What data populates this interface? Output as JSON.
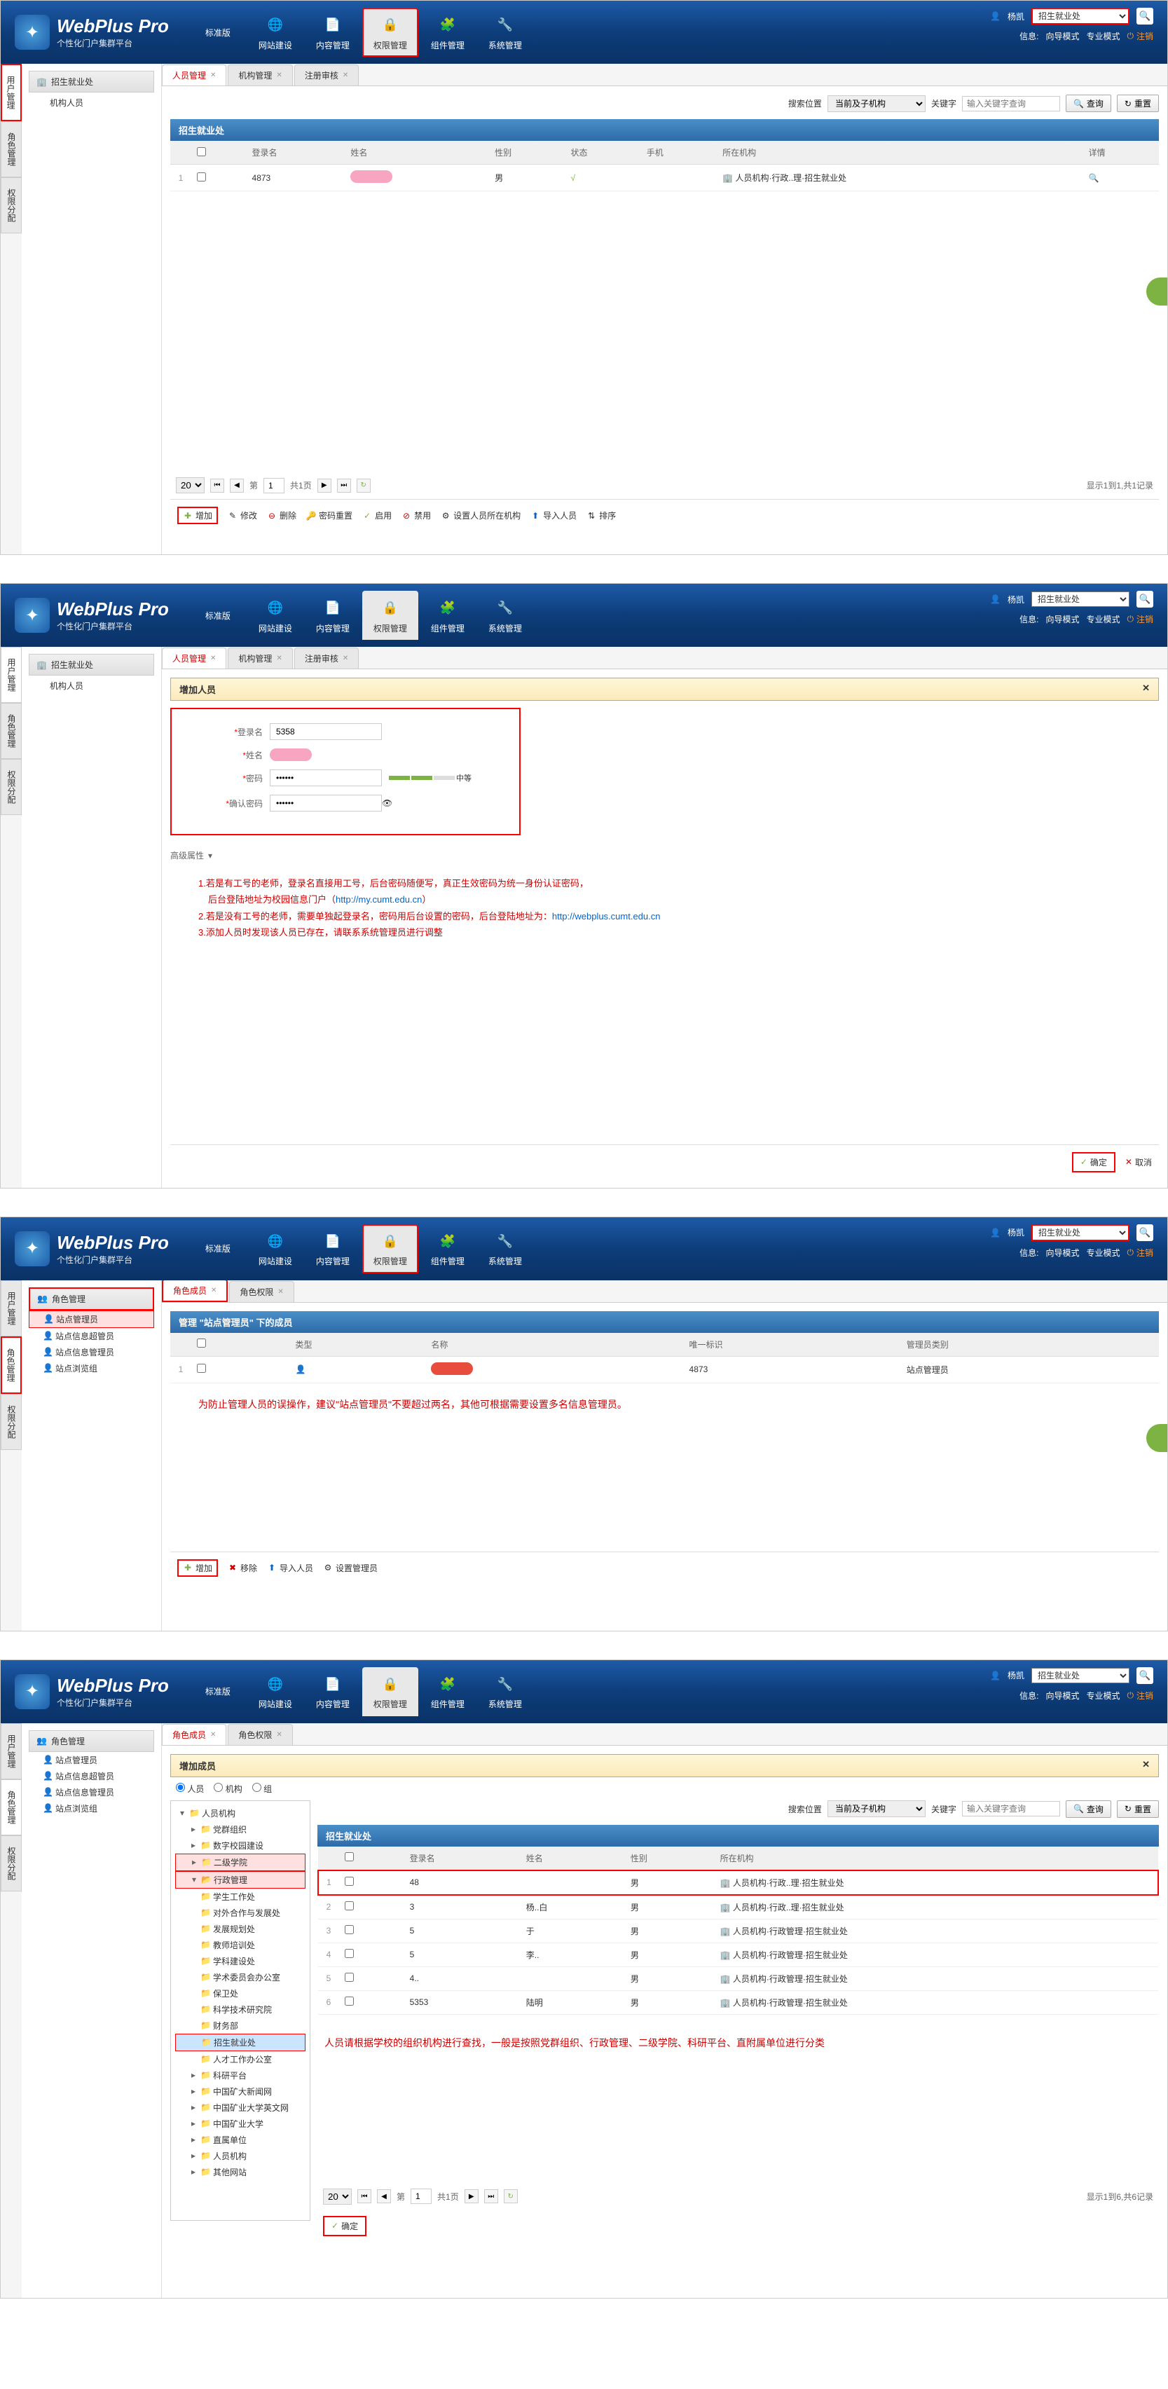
{
  "logo": {
    "title": "WebPlus Pro",
    "sub": "个性化门户集群平台"
  },
  "nav": {
    "std": "标准版",
    "site": "网站建设",
    "content": "内容管理",
    "perm": "权限管理",
    "comp": "组件管理",
    "sys": "系统管理"
  },
  "header": {
    "user": "杨凯",
    "site_sel": "招生就业处",
    "guide": "向导模式",
    "pro": "专业模式",
    "info": "信息:",
    "logout": "注销"
  },
  "left": {
    "user": "用户管理",
    "role": "角色管理",
    "perm": "权限分配"
  },
  "s1": {
    "sidebar_header": "招生就业处",
    "sidebar_item": "机构人员",
    "tabs": {
      "t1": "人员管理",
      "t2": "机构管理",
      "t3": "注册审核"
    },
    "search": {
      "loc": "搜索位置",
      "scope": "当前及子机构",
      "kw": "关键字",
      "ph": "输入关键字查询",
      "q": "查询",
      "r": "重置"
    },
    "panel": "招生就业处",
    "th": {
      "login": "登录名",
      "name": "姓名",
      "sex": "性别",
      "status": "状态",
      "phone": "手机",
      "org": "所在机构",
      "detail": "详情"
    },
    "row": {
      "num": "1",
      "login": "4873",
      "sex": "男",
      "status": "√",
      "org": "人员机构·行政..理·招生就业处"
    },
    "pager": {
      "size": "20",
      "page": "1",
      "of": "第",
      "total": "共1页",
      "info": "显示1到1,共1记录"
    },
    "tools": {
      "add": "增加",
      "edit": "修改",
      "del": "删除",
      "pwd": "密码重置",
      "enable": "启用",
      "disable": "禁用",
      "org": "设置人员所在机构",
      "import": "导入人员",
      "sort": "排序"
    }
  },
  "s2": {
    "title": "增加人员",
    "form": {
      "login_l": "登录名",
      "login_v": "5358",
      "name_l": "姓名",
      "pwd_l": "密码",
      "pwd_v": "••••••",
      "cpwd_l": "确认密码",
      "cpwd_v": "••••••",
      "strength": "中等"
    },
    "adv": "高级属性",
    "inst1": "1.若是有工号的老师，登录名直接用工号，后台密码随便写，真正生效密码为统一身份认证密码，",
    "inst1b": "后台登陆地址为校园信息门户（",
    "url1": "http://my.cumt.edu.cn",
    "inst1c": "）",
    "inst2": "2.若是没有工号的老师，需要单独起登录名，密码用后台设置的密码，后台登陆地址为：",
    "url2": "http://webplus.cumt.edu.cn",
    "inst3": "3.添加人员时发现该人员已存在，请联系系统管理员进行调整",
    "ok": "确定",
    "cancel": "取消"
  },
  "s3": {
    "sidebar_header": "角色管理",
    "tree": {
      "i1": "站点管理员",
      "i2": "站点信息超管员",
      "i3": "站点信息管理员",
      "i4": "站点浏览组"
    },
    "tabs": {
      "t1": "角色成员",
      "t2": "角色权限"
    },
    "panel": "管理 \"站点管理员\" 下的成员",
    "th": {
      "type": "类型",
      "name": "名称",
      "uid": "唯一标识",
      "role": "管理员类别"
    },
    "row": {
      "num": "1",
      "uid": "4873",
      "role": "站点管理员"
    },
    "warning": "为防止管理人员的误操作，建议\"站点管理员\"不要超过两名，其他可根据需要设置多名信息管理员。",
    "tools": {
      "add": "增加",
      "rem": "移除",
      "import": "导入人员",
      "set": "设置管理员"
    }
  },
  "s4": {
    "title": "增加成员",
    "radio": {
      "person": "人员",
      "org": "机构",
      "group": "组"
    },
    "tree": {
      "root": "人员机构",
      "i1": "党群组织",
      "i2": "数字校园建设",
      "i3": "二级学院",
      "i4": "行政管理",
      "i4a": "学生工作处",
      "i4b": "对外合作与发展处",
      "i4c": "发展规划处",
      "i4d": "教师培训处",
      "i4e": "学科建设处",
      "i4f": "学术委员会办公室",
      "i4g": "保卫处",
      "i4h": "科学技术研究院",
      "i4i": "财务部",
      "i4j": "招生就业处",
      "i4k": "人才工作办公室",
      "i5": "科研平台",
      "i6": "中国矿大新闻网",
      "i7": "中国矿业大学英文网",
      "i8": "中国矿业大学",
      "i9": "直属单位",
      "i10": "人员机构",
      "i11": "其他网站"
    },
    "panel": "招生就业处",
    "th": {
      "login": "登录名",
      "name": "姓名",
      "sex": "性别",
      "org": "所在机构"
    },
    "rows": [
      {
        "n": "1",
        "login": "48",
        "sex": "男",
        "org": "人员机构·行政..理·招生就业处"
      },
      {
        "n": "2",
        "login": "3",
        "name": "杨..白",
        "sex": "男",
        "org": "人员机构·行政..理·招生就业处"
      },
      {
        "n": "3",
        "login": "5",
        "name": "于",
        "sex": "男",
        "org": "人员机构·行政管理·招生就业处"
      },
      {
        "n": "4",
        "login": "5",
        "name": "李..",
        "sex": "男",
        "org": "人员机构·行政管理·招生就业处"
      },
      {
        "n": "5",
        "login": "4..",
        "sex": "男",
        "org": "人员机构·行政管理·招生就业处"
      },
      {
        "n": "6",
        "login": "5353",
        "name": "陆明",
        "sex": "男",
        "org": "人员机构·行政管理·招生就业处"
      }
    ],
    "note": "人员请根据学校的组织机构进行查找，一般是按照党群组织、行政管理、二级学院、科研平台、直附属单位进行分类",
    "pager": {
      "size": "20",
      "page": "1",
      "of": "第",
      "total": "共1页",
      "info": "显示1到6,共6记录"
    },
    "ok": "确定"
  }
}
